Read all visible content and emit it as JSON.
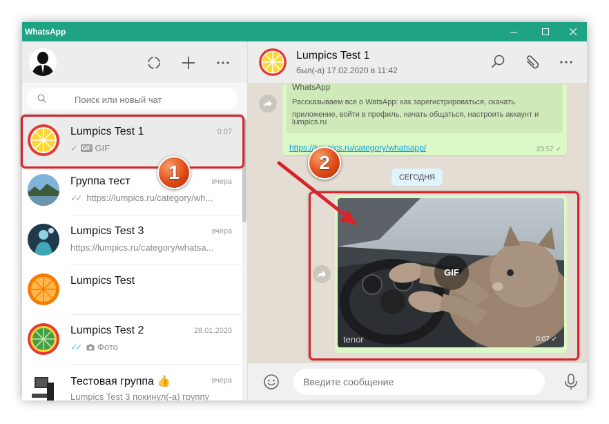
{
  "window": {
    "title": "WhatsApp",
    "accent": "#1fa483"
  },
  "sidebar": {
    "search_placeholder": "Поиск или новый чат",
    "header_icons": [
      "status-icon",
      "new-chat-icon",
      "menu-icon"
    ],
    "chats": [
      {
        "name": "Lumpics Test 1",
        "time": "0:07",
        "preview_badge": "GIF",
        "preview": "GIF",
        "check": "✓",
        "selected": true
      },
      {
        "name": "Группа тест",
        "time": "вчера",
        "preview": "https://lumpics.ru/category/wh...",
        "check": "✓✓"
      },
      {
        "name": "Lumpics Test 3",
        "time": "вчера",
        "preview": "https://lumpics.ru/category/whatsa..."
      },
      {
        "name": "Lumpics Test",
        "time": "",
        "preview": ""
      },
      {
        "name": "Lumpics Test 2",
        "time": "28.01.2020",
        "preview": "Фото",
        "check": "✓✓"
      },
      {
        "name": "Тестовая группа 👍",
        "time": "вчера",
        "preview": "Lumpics Test 3 покинул(-а) группу"
      }
    ]
  },
  "conversation": {
    "title": "Lumpics Test 1",
    "status": "был(-а) 17.02.2020 в 11:42",
    "link_preview": {
      "title": "WhatsApp",
      "description": "Рассказываем все о WatsApp: как зарегистрироваться, скачать приложение, войти в профиль, начать общаться, настроить аккаунт и",
      "site": "lumpics.ru"
    },
    "link_text": "https://lumpics.ru/category/whatsapp/",
    "link_time": "23:57 ✓",
    "date_divider": "СЕГОДНЯ",
    "gif_message": {
      "badge": "GIF",
      "watermark": "tenor",
      "time": "0:07 ✓"
    },
    "composer_placeholder": "Введите сообщение"
  },
  "annotations": {
    "step1": "1",
    "step2": "2",
    "color": "#d8232a"
  }
}
